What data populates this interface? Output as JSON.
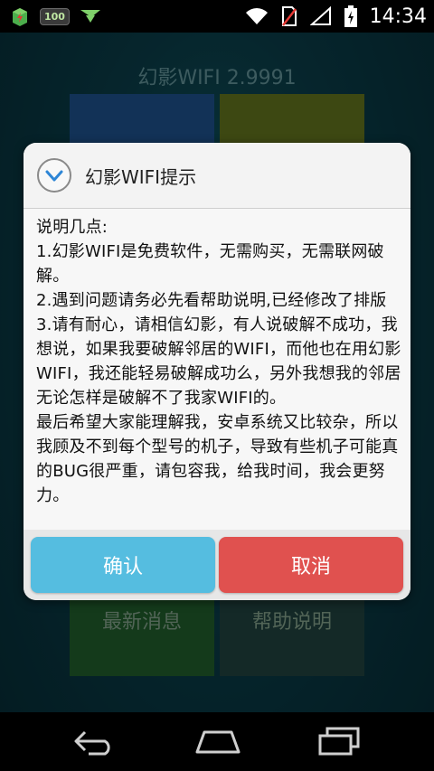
{
  "status_bar": {
    "battery_badge": "100",
    "time": "14:34"
  },
  "app": {
    "title": "幻影WIFI 2.9991",
    "tiles": [
      {
        "label": "最新消息"
      },
      {
        "label": "帮助说明"
      }
    ]
  },
  "dialog": {
    "title": "幻影WIFI提示",
    "body": "说明几点:\n1.幻影WIFI是免费软件，无需购买，无需联网破解。\n2.遇到问题请务必先看帮助说明,已经修改了排版\n3.请有耐心，请相信幻影，有人说破解不成功，我想说，如果我要破解邻居的WIFI，而他也在用幻影WIFI，我还能轻易破解成功么，另外我想我的邻居无论怎样是破解不了我家WIFI的。\n最后希望大家能理解我，安卓系统又比较杂，所以我顾及不到每个型号的机子，导致有些机子可能真的BUG很严重，请包容我，给我时间，我会更努力。",
    "confirm_label": "确认",
    "cancel_label": "取消"
  },
  "colors": {
    "confirm": "#55bde0",
    "cancel": "#e0514f",
    "tile_blue": "#1d4e86",
    "tile_olive": "#5f6f1d",
    "tile_bottom_left": "#1f5a2a",
    "tile_bottom_right": "#1f3f3c"
  },
  "icons": {
    "status_left": [
      "app-notification-icon",
      "battery-100-icon",
      "download-arrow-icon"
    ],
    "status_right": [
      "wifi-icon",
      "no-sim-icon",
      "no-signal-icon",
      "battery-charging-icon"
    ],
    "dialog": "chevron-down-circle-icon",
    "nav": [
      "back-icon",
      "home-icon",
      "recents-icon"
    ]
  }
}
